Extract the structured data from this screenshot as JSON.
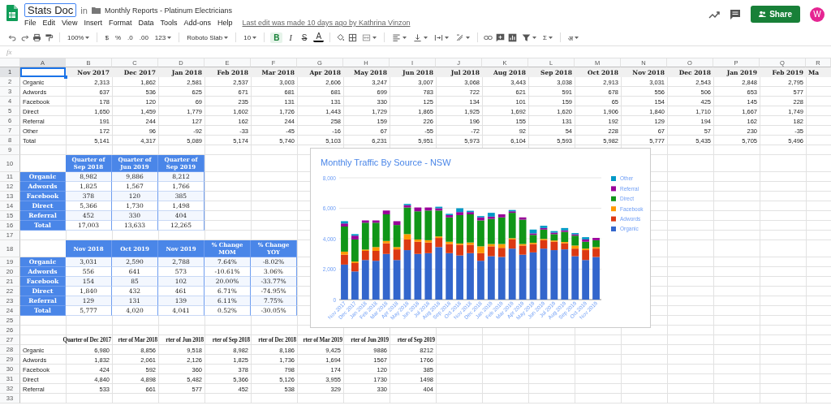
{
  "app": {
    "title": "Stats Doc",
    "in_label": "in",
    "folder": "Monthly Reports - Platinum Electricians",
    "menu": [
      "File",
      "Edit",
      "View",
      "Insert",
      "Format",
      "Data",
      "Tools",
      "Add-ons",
      "Help"
    ],
    "last_edit": "Last edit was made 10 days ago by Kathrina Vinzon",
    "share_label": "Share",
    "avatar": "W"
  },
  "toolbar": [
    {
      "kind": "icon"
    },
    {
      "kind": "icon"
    },
    {
      "kind": "icon"
    },
    {
      "kind": "icon"
    },
    {
      "kind": "sep"
    },
    {
      "kind": "dropdown",
      "text": "100%"
    },
    {
      "kind": "sep"
    },
    {
      "kind": "text",
      "text": "$"
    },
    {
      "kind": "text",
      "text": "%"
    },
    {
      "kind": "text",
      "text": ".0"
    },
    {
      "kind": "text",
      "text": ".00"
    },
    {
      "kind": "dropdown",
      "text": "123"
    },
    {
      "kind": "sep"
    },
    {
      "kind": "dropdown",
      "text": "Roboto Slab"
    },
    {
      "kind": "sep"
    },
    {
      "kind": "dropdown",
      "text": "10"
    },
    {
      "kind": "sep"
    },
    {
      "kind": "bold",
      "text": "B",
      "selected": true
    },
    {
      "kind": "italic",
      "text": "I",
      "selected": false
    },
    {
      "kind": "strike",
      "text": "S",
      "selected": false
    },
    {
      "kind": "text-color",
      "text": "A"
    },
    {
      "kind": "sep"
    },
    {
      "kind": "icon"
    },
    {
      "kind": "icon"
    },
    {
      "kind": "icon-menu"
    },
    {
      "kind": "sep"
    },
    {
      "kind": "icon-menu"
    },
    {
      "kind": "icon-menu"
    },
    {
      "kind": "icon-menu"
    },
    {
      "kind": "icon-menu"
    },
    {
      "kind": "sep"
    },
    {
      "kind": "icon"
    },
    {
      "kind": "icon"
    },
    {
      "kind": "icon"
    },
    {
      "kind": "icon-menu"
    },
    {
      "kind": "dropdown",
      "text": "Σ"
    },
    {
      "kind": "sep"
    },
    {
      "kind": "dropdown",
      "text": "अ"
    }
  ],
  "formula_bar": {
    "label": "fx"
  },
  "sheet": {
    "columns": [
      {
        "label": "A",
        "selected": true
      },
      {
        "label": "B",
        "selected": false
      },
      {
        "label": "C",
        "selected": false
      },
      {
        "label": "D",
        "selected": false
      },
      {
        "label": "E",
        "selected": false
      },
      {
        "label": "F",
        "selected": false
      },
      {
        "label": "G",
        "selected": false
      },
      {
        "label": "H",
        "selected": false
      },
      {
        "label": "I",
        "selected": false
      },
      {
        "label": "J",
        "selected": false
      },
      {
        "label": "K",
        "selected": false
      },
      {
        "label": "L",
        "selected": false
      },
      {
        "label": "M",
        "selected": false
      },
      {
        "label": "N",
        "selected": false
      },
      {
        "label": "O",
        "selected": false
      },
      {
        "label": "P",
        "selected": false
      },
      {
        "label": "Q",
        "selected": false
      },
      {
        "label": "R",
        "selected": false
      }
    ],
    "row_numbers": [
      {
        "label": "1",
        "selected": true
      },
      {
        "label": "2",
        "selected": false
      },
      {
        "label": "3",
        "selected": false
      },
      {
        "label": "4",
        "selected": false
      },
      {
        "label": "5",
        "selected": false
      },
      {
        "label": "6",
        "selected": false
      },
      {
        "label": "7",
        "selected": false
      },
      {
        "label": "8",
        "selected": false
      },
      {
        "label": "9",
        "selected": false
      },
      {
        "label": "10",
        "selected": false
      },
      {
        "label": "11",
        "selected": false
      },
      {
        "label": "12",
        "selected": false
      },
      {
        "label": "13",
        "selected": false
      },
      {
        "label": "14",
        "selected": false
      },
      {
        "label": "15",
        "selected": false
      },
      {
        "label": "16",
        "selected": false
      },
      {
        "label": "17",
        "selected": false
      },
      {
        "label": "18",
        "selected": false
      },
      {
        "label": "19",
        "selected": false
      },
      {
        "label": "20",
        "selected": false
      },
      {
        "label": "21",
        "selected": false
      },
      {
        "label": "22",
        "selected": false
      },
      {
        "label": "23",
        "selected": false
      },
      {
        "label": "24",
        "selected": false
      },
      {
        "label": "25",
        "selected": false
      },
      {
        "label": "26",
        "selected": false
      },
      {
        "label": "27",
        "selected": false
      },
      {
        "label": "28",
        "selected": false
      },
      {
        "label": "29",
        "selected": false
      },
      {
        "label": "30",
        "selected": false
      },
      {
        "label": "31",
        "selected": false
      },
      {
        "label": "32",
        "selected": false
      },
      {
        "label": "33",
        "selected": false
      }
    ]
  },
  "tables": [
    {
      "kind": "shaded",
      "columns": [
        "Nov 2017",
        "Dec 2017",
        "Jan 2018",
        "Feb 2018",
        "Mar 2018",
        "Apr 2018",
        "May 2018",
        "Jun 2018",
        "Jul 2018",
        "Aug 2018",
        "Sep 2018",
        "Oct 2018",
        "Nov 2018",
        "Dec 2018",
        "Jan 2019",
        "Feb 2019",
        "Ma"
      ],
      "rows": [
        {
          "label": "Organic",
          "values": [
            "2,313",
            "1,862",
            "2,581",
            "2,537",
            "3,003",
            "2,606",
            "3,247",
            "3,007",
            "3,068",
            "3,443",
            "3,038",
            "2,913",
            "3,031",
            "2,543",
            "2,848",
            "2,795"
          ]
        },
        {
          "label": "Adwords",
          "values": [
            "637",
            "536",
            "625",
            "671",
            "681",
            "681",
            "699",
            "783",
            "722",
            "621",
            "591",
            "678",
            "556",
            "506",
            "653",
            "577"
          ]
        },
        {
          "label": "Facebook",
          "values": [
            "178",
            "120",
            "69",
            "235",
            "131",
            "131",
            "330",
            "125",
            "134",
            "101",
            "159",
            "65",
            "154",
            "425",
            "145",
            "228"
          ]
        },
        {
          "label": "Direct",
          "values": [
            "1,650",
            "1,459",
            "1,779",
            "1,602",
            "1,726",
            "1,443",
            "1,729",
            "1,865",
            "1,925",
            "1,692",
            "1,620",
            "1,906",
            "1,840",
            "1,710",
            "1,667",
            "1,749"
          ]
        },
        {
          "label": "Referral",
          "values": [
            "191",
            "244",
            "127",
            "162",
            "244",
            "258",
            "159",
            "226",
            "196",
            "155",
            "131",
            "192",
            "129",
            "194",
            "162",
            "182"
          ]
        },
        {
          "label": "Other",
          "values": [
            "172",
            "96",
            "-92",
            "-33",
            "-45",
            "-16",
            "67",
            "-55",
            "-72",
            "92",
            "54",
            "228",
            "67",
            "57",
            "230",
            "-35"
          ]
        },
        {
          "label": "Total",
          "values": [
            "5,141",
            "4,317",
            "5,089",
            "5,174",
            "5,740",
            "5,103",
            "6,231",
            "5,951",
            "5,973",
            "6,104",
            "5,593",
            "5,982",
            "5,777",
            "5,435",
            "5,705",
            "5,496"
          ]
        }
      ]
    },
    {
      "kind": "blue",
      "columns": [
        "Quarter of Sep 2018",
        "Quarter of Jun 2019",
        "Quarter of Sep 2019"
      ],
      "rows": [
        {
          "label": "Organic",
          "values": [
            "8,982",
            "9,886",
            "8,212"
          ]
        },
        {
          "label": "Adwords",
          "values": [
            "1,825",
            "1,567",
            "1,766"
          ]
        },
        {
          "label": "Facebook",
          "values": [
            "378",
            "120",
            "385"
          ]
        },
        {
          "label": "Direct",
          "values": [
            "5,366",
            "1,730",
            "1,498"
          ]
        },
        {
          "label": "Referral",
          "values": [
            "452",
            "330",
            "404"
          ]
        },
        {
          "label": "Total",
          "values": [
            "17,003",
            "13,633",
            "12,265"
          ]
        }
      ]
    },
    {
      "kind": "blue",
      "columns": [
        "Nov 2018",
        "Oct 2019",
        "Nov 2019",
        "% Change MOM",
        "% Change YOY"
      ],
      "rows": [
        {
          "label": "Organic",
          "values": [
            "3,031",
            "2,590",
            "2,788",
            "7.64%",
            "-8.02%"
          ]
        },
        {
          "label": "Adwords",
          "values": [
            "556",
            "641",
            "573",
            "-10.61%",
            "3.06%"
          ]
        },
        {
          "label": "Facebook",
          "values": [
            "154",
            "85",
            "102",
            "20.00%",
            "-33.77%"
          ]
        },
        {
          "label": "Direct",
          "values": [
            "1,840",
            "432",
            "461",
            "6.71%",
            "-74.95%"
          ]
        },
        {
          "label": "Referral",
          "values": [
            "129",
            "131",
            "139",
            "6.11%",
            "7.75%"
          ]
        },
        {
          "label": "Total",
          "values": [
            "5,777",
            "4,020",
            "4,041",
            "0.52%",
            "-30.05%"
          ]
        }
      ]
    },
    {
      "kind": "plain",
      "columns": [
        "Quarter of Dec 2017",
        "rter of Mar 2018",
        "rter of Jun 2018",
        "rter of Sep 2018",
        "rter of Dec 2018",
        "rter of Mar 2019",
        "rter of Jun 2019",
        "rter of Sep 2019"
      ],
      "rows": [
        {
          "label": "Organic",
          "values": [
            "6,980",
            "8,856",
            "9,518",
            "8,982",
            "8,186",
            "9,425",
            "9886",
            "8212"
          ]
        },
        {
          "label": "Adwords",
          "values": [
            "1,832",
            "2,061",
            "2,126",
            "1,825",
            "1,736",
            "1,694",
            "1567",
            "1766"
          ]
        },
        {
          "label": "Facebook",
          "values": [
            "424",
            "592",
            "360",
            "378",
            "798",
            "174",
            "120",
            "385"
          ]
        },
        {
          "label": "Direct",
          "values": [
            "4,840",
            "4,898",
            "5,482",
            "5,366",
            "5,126",
            "3,955",
            "1730",
            "1498"
          ]
        },
        {
          "label": "Referral",
          "values": [
            "533",
            "661",
            "577",
            "452",
            "538",
            "329",
            "330",
            "404"
          ]
        }
      ]
    }
  ],
  "chart": {
    "chart_data": {
      "type": "bar",
      "title": "Monthly Traffic By Source - NSW",
      "stacked": true,
      "orientation": "vertical",
      "categories": [
        "Nov 2017",
        "Dec 2017",
        "Jan 2018",
        "Feb 2018",
        "Mar 2018",
        "Apr 2018",
        "May 2018",
        "Jun 2018",
        "Jul 2018",
        "Aug 2018",
        "Sep 2018",
        "Oct 2018",
        "Nov 2018",
        "Dec 2018",
        "Jan 2019",
        "Feb 2019",
        "Mar 2019",
        "Apr 2019",
        "May 2019",
        "Jun 2019",
        "Jul 2019",
        "Aug 2019",
        "Sep 2019",
        "Oct 2019",
        "Nov 2019"
      ],
      "ylim": [
        0,
        8000
      ],
      "grid": true,
      "legend": true,
      "yticks": [
        {
          "value": 0,
          "label": "0"
        },
        {
          "value": 2000,
          "label": "2,000"
        },
        {
          "value": 4000,
          "label": "4,000"
        },
        {
          "value": 6000,
          "label": "6,000"
        },
        {
          "value": 8000,
          "label": "8,000"
        }
      ],
      "series": [
        {
          "name": "Organic",
          "color": "#3366cc",
          "values": [
            2300,
            1850,
            2600,
            2550,
            3000,
            2600,
            3250,
            3000,
            3050,
            3450,
            3050,
            2900,
            3050,
            2550,
            2850,
            2800,
            3350,
            2950,
            3100,
            3350,
            3250,
            3300,
            2850,
            2600,
            2800
          ]
        },
        {
          "name": "Adwords",
          "color": "#dc3912",
          "values": [
            650,
            550,
            600,
            650,
            700,
            700,
            700,
            800,
            700,
            600,
            600,
            700,
            550,
            500,
            650,
            600,
            600,
            600,
            550,
            550,
            550,
            400,
            500,
            650,
            550
          ]
        },
        {
          "name": "Facebook",
          "color": "#ff9900",
          "values": [
            200,
            100,
            50,
            250,
            150,
            150,
            350,
            150,
            150,
            100,
            150,
            50,
            150,
            450,
            150,
            250,
            50,
            100,
            50,
            50,
            50,
            50,
            200,
            100,
            100
          ]
        },
        {
          "name": "Direct",
          "color": "#109618",
          "values": [
            1650,
            1450,
            1800,
            1600,
            1750,
            1450,
            1750,
            1850,
            1950,
            1700,
            1600,
            1900,
            1850,
            1700,
            1650,
            1750,
            1700,
            1600,
            550,
            650,
            450,
            700,
            650,
            450,
            450
          ]
        },
        {
          "name": "Referral",
          "color": "#990099",
          "values": [
            200,
            250,
            150,
            150,
            250,
            250,
            150,
            250,
            200,
            150,
            150,
            200,
            150,
            200,
            150,
            200,
            100,
            150,
            100,
            100,
            100,
            100,
            50,
            150,
            150
          ]
        },
        {
          "name": "Other",
          "color": "#0099c6",
          "values": [
            150,
            100,
            null,
            null,
            null,
            null,
            50,
            null,
            null,
            100,
            50,
            250,
            50,
            50,
            250,
            null,
            50,
            null,
            250,
            150,
            100,
            150,
            50,
            150,
            null
          ]
        }
      ]
    }
  }
}
